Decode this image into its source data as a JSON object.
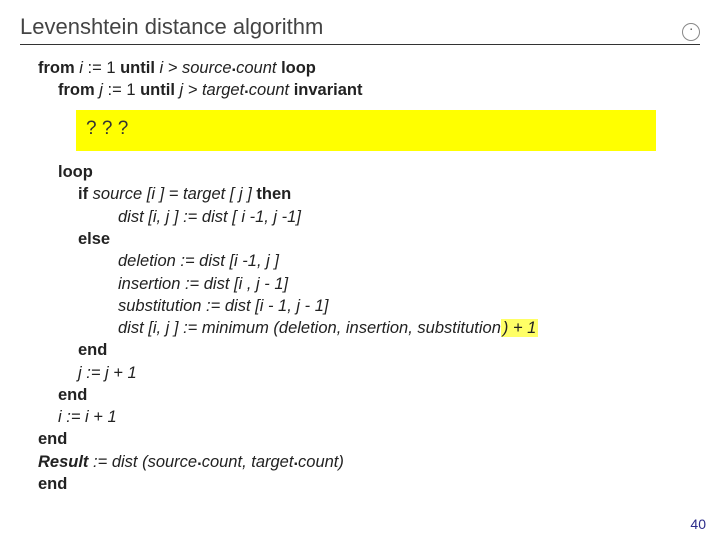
{
  "title": "Levenshtein distance algorithm",
  "logo": "·",
  "code": {
    "l1_from": "from",
    "l1_var": " i ",
    "l1_assign": ":= 1 ",
    "l1_until": "until",
    "l1_cond": " i > source",
    "l1_dot": ".",
    "l1_count": "count  ",
    "l1_loop": "loop",
    "l2_from": "from",
    "l2_var": " j ",
    "l2_assign": ":= 1 ",
    "l2_until": "until",
    "l2_cond": " j > target",
    "l2_dot": ".",
    "l2_count": "count ",
    "l2_inv": "invariant",
    "question": "? ? ?",
    "l3_loop": "loop",
    "l4_if": "if",
    "l4_cond": " source [i ] = target [ j ] ",
    "l4_then": "then",
    "l5": "dist [i, j ] := dist [ i -1, j -1]",
    "l6_else": "else",
    "l7": "deletion := dist [i -1, j ]",
    "l8": "insertion := dist [i , j - 1]",
    "l9": "substitution := dist [i - 1, j - 1]",
    "l10a": "dist [i, j ] := minimum (deletion, insertion, substitution",
    "l10b": ") + 1",
    "l11_end": "end",
    "l12": "j := j + 1",
    "l13_end": "end",
    "l14": "i := i + 1",
    "l15_end": "end",
    "l16a": "Result",
    "l16b": " := dist (source",
    "l16c": "count, target",
    "l16d": "count)",
    "l17_end": "end"
  },
  "pagenum": "40"
}
